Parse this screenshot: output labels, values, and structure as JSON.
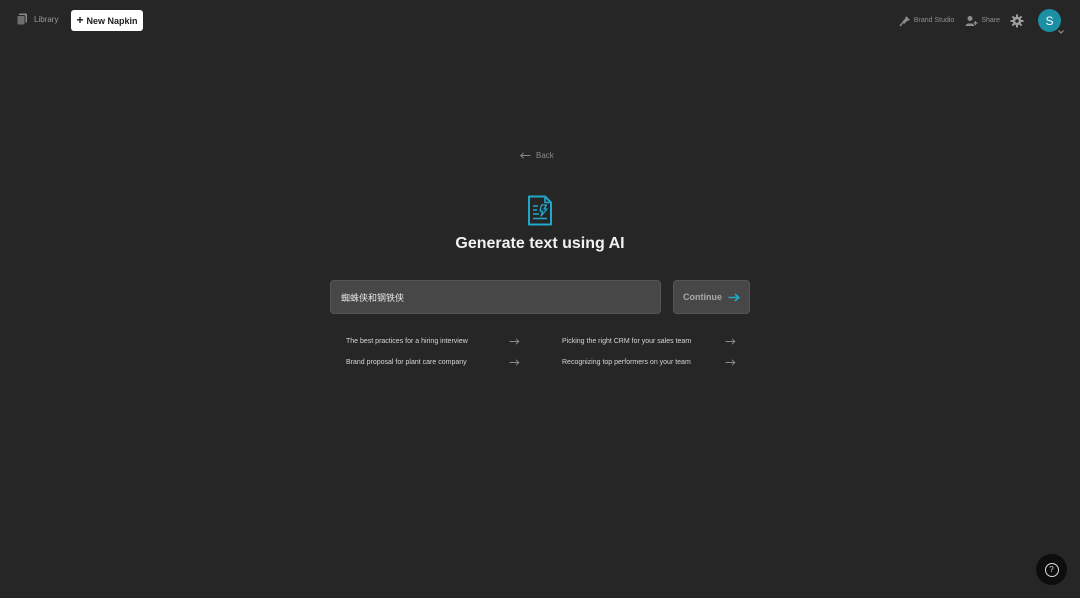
{
  "topbar": {
    "library_label": "Library",
    "new_napkin_label": "New Napkin",
    "brand_studio_label": "Brand Studio",
    "share_label": "Share",
    "avatar_initial": "S"
  },
  "main": {
    "back_label": "Back",
    "title": "Generate text using AI",
    "prompt_value": "蜘蛛侠和钢铁侠",
    "continue_label": "Continue",
    "suggestions": [
      {
        "label": "The best practices for a hiring interview"
      },
      {
        "label": "Picking the right CRM for your sales team"
      },
      {
        "label": "Brand proposal for plant care company"
      },
      {
        "label": "Recognizing top performers on your team"
      }
    ]
  },
  "help_label": "?",
  "colors": {
    "background": "#262626",
    "accent": "#1fa9c9",
    "avatar": "#1b8fa3"
  },
  "icons": [
    "library-icon",
    "plus-icon",
    "brand-studio-icon",
    "share-icon",
    "gear-icon",
    "back-arrow-icon",
    "document-ai-icon",
    "arrow-right-icon",
    "help-icon"
  ]
}
